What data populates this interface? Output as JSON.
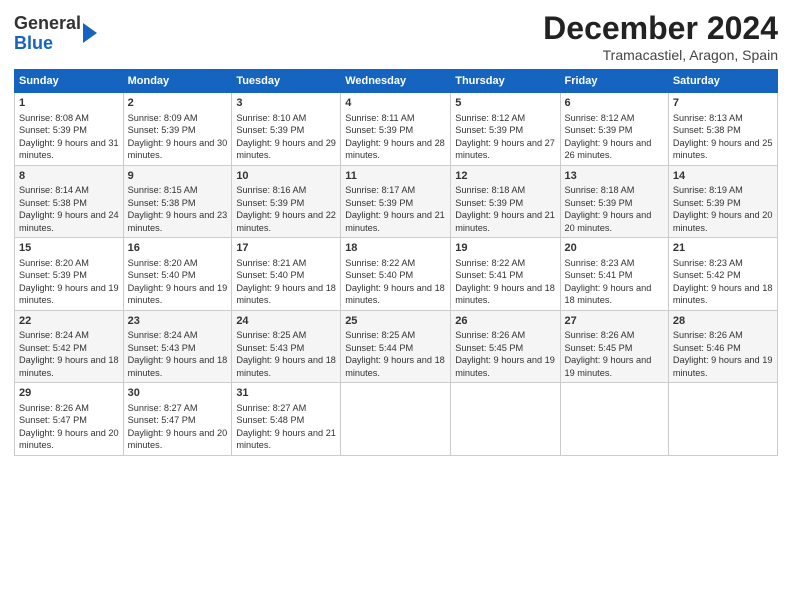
{
  "header": {
    "logo_general": "General",
    "logo_blue": "Blue",
    "title": "December 2024",
    "subtitle": "Tramacastiel, Aragon, Spain"
  },
  "columns": [
    "Sunday",
    "Monday",
    "Tuesday",
    "Wednesday",
    "Thursday",
    "Friday",
    "Saturday"
  ],
  "weeks": [
    [
      {
        "day": "1",
        "sunrise": "Sunrise: 8:08 AM",
        "sunset": "Sunset: 5:39 PM",
        "daylight": "Daylight: 9 hours and 31 minutes."
      },
      {
        "day": "2",
        "sunrise": "Sunrise: 8:09 AM",
        "sunset": "Sunset: 5:39 PM",
        "daylight": "Daylight: 9 hours and 30 minutes."
      },
      {
        "day": "3",
        "sunrise": "Sunrise: 8:10 AM",
        "sunset": "Sunset: 5:39 PM",
        "daylight": "Daylight: 9 hours and 29 minutes."
      },
      {
        "day": "4",
        "sunrise": "Sunrise: 8:11 AM",
        "sunset": "Sunset: 5:39 PM",
        "daylight": "Daylight: 9 hours and 28 minutes."
      },
      {
        "day": "5",
        "sunrise": "Sunrise: 8:12 AM",
        "sunset": "Sunset: 5:39 PM",
        "daylight": "Daylight: 9 hours and 27 minutes."
      },
      {
        "day": "6",
        "sunrise": "Sunrise: 8:12 AM",
        "sunset": "Sunset: 5:39 PM",
        "daylight": "Daylight: 9 hours and 26 minutes."
      },
      {
        "day": "7",
        "sunrise": "Sunrise: 8:13 AM",
        "sunset": "Sunset: 5:38 PM",
        "daylight": "Daylight: 9 hours and 25 minutes."
      }
    ],
    [
      {
        "day": "8",
        "sunrise": "Sunrise: 8:14 AM",
        "sunset": "Sunset: 5:38 PM",
        "daylight": "Daylight: 9 hours and 24 minutes."
      },
      {
        "day": "9",
        "sunrise": "Sunrise: 8:15 AM",
        "sunset": "Sunset: 5:38 PM",
        "daylight": "Daylight: 9 hours and 23 minutes."
      },
      {
        "day": "10",
        "sunrise": "Sunrise: 8:16 AM",
        "sunset": "Sunset: 5:39 PM",
        "daylight": "Daylight: 9 hours and 22 minutes."
      },
      {
        "day": "11",
        "sunrise": "Sunrise: 8:17 AM",
        "sunset": "Sunset: 5:39 PM",
        "daylight": "Daylight: 9 hours and 21 minutes."
      },
      {
        "day": "12",
        "sunrise": "Sunrise: 8:18 AM",
        "sunset": "Sunset: 5:39 PM",
        "daylight": "Daylight: 9 hours and 21 minutes."
      },
      {
        "day": "13",
        "sunrise": "Sunrise: 8:18 AM",
        "sunset": "Sunset: 5:39 PM",
        "daylight": "Daylight: 9 hours and 20 minutes."
      },
      {
        "day": "14",
        "sunrise": "Sunrise: 8:19 AM",
        "sunset": "Sunset: 5:39 PM",
        "daylight": "Daylight: 9 hours and 20 minutes."
      }
    ],
    [
      {
        "day": "15",
        "sunrise": "Sunrise: 8:20 AM",
        "sunset": "Sunset: 5:39 PM",
        "daylight": "Daylight: 9 hours and 19 minutes."
      },
      {
        "day": "16",
        "sunrise": "Sunrise: 8:20 AM",
        "sunset": "Sunset: 5:40 PM",
        "daylight": "Daylight: 9 hours and 19 minutes."
      },
      {
        "day": "17",
        "sunrise": "Sunrise: 8:21 AM",
        "sunset": "Sunset: 5:40 PM",
        "daylight": "Daylight: 9 hours and 18 minutes."
      },
      {
        "day": "18",
        "sunrise": "Sunrise: 8:22 AM",
        "sunset": "Sunset: 5:40 PM",
        "daylight": "Daylight: 9 hours and 18 minutes."
      },
      {
        "day": "19",
        "sunrise": "Sunrise: 8:22 AM",
        "sunset": "Sunset: 5:41 PM",
        "daylight": "Daylight: 9 hours and 18 minutes."
      },
      {
        "day": "20",
        "sunrise": "Sunrise: 8:23 AM",
        "sunset": "Sunset: 5:41 PM",
        "daylight": "Daylight: 9 hours and 18 minutes."
      },
      {
        "day": "21",
        "sunrise": "Sunrise: 8:23 AM",
        "sunset": "Sunset: 5:42 PM",
        "daylight": "Daylight: 9 hours and 18 minutes."
      }
    ],
    [
      {
        "day": "22",
        "sunrise": "Sunrise: 8:24 AM",
        "sunset": "Sunset: 5:42 PM",
        "daylight": "Daylight: 9 hours and 18 minutes."
      },
      {
        "day": "23",
        "sunrise": "Sunrise: 8:24 AM",
        "sunset": "Sunset: 5:43 PM",
        "daylight": "Daylight: 9 hours and 18 minutes."
      },
      {
        "day": "24",
        "sunrise": "Sunrise: 8:25 AM",
        "sunset": "Sunset: 5:43 PM",
        "daylight": "Daylight: 9 hours and 18 minutes."
      },
      {
        "day": "25",
        "sunrise": "Sunrise: 8:25 AM",
        "sunset": "Sunset: 5:44 PM",
        "daylight": "Daylight: 9 hours and 18 minutes."
      },
      {
        "day": "26",
        "sunrise": "Sunrise: 8:26 AM",
        "sunset": "Sunset: 5:45 PM",
        "daylight": "Daylight: 9 hours and 19 minutes."
      },
      {
        "day": "27",
        "sunrise": "Sunrise: 8:26 AM",
        "sunset": "Sunset: 5:45 PM",
        "daylight": "Daylight: 9 hours and 19 minutes."
      },
      {
        "day": "28",
        "sunrise": "Sunrise: 8:26 AM",
        "sunset": "Sunset: 5:46 PM",
        "daylight": "Daylight: 9 hours and 19 minutes."
      }
    ],
    [
      {
        "day": "29",
        "sunrise": "Sunrise: 8:26 AM",
        "sunset": "Sunset: 5:47 PM",
        "daylight": "Daylight: 9 hours and 20 minutes."
      },
      {
        "day": "30",
        "sunrise": "Sunrise: 8:27 AM",
        "sunset": "Sunset: 5:47 PM",
        "daylight": "Daylight: 9 hours and 20 minutes."
      },
      {
        "day": "31",
        "sunrise": "Sunrise: 8:27 AM",
        "sunset": "Sunset: 5:48 PM",
        "daylight": "Daylight: 9 hours and 21 minutes."
      },
      null,
      null,
      null,
      null
    ]
  ]
}
